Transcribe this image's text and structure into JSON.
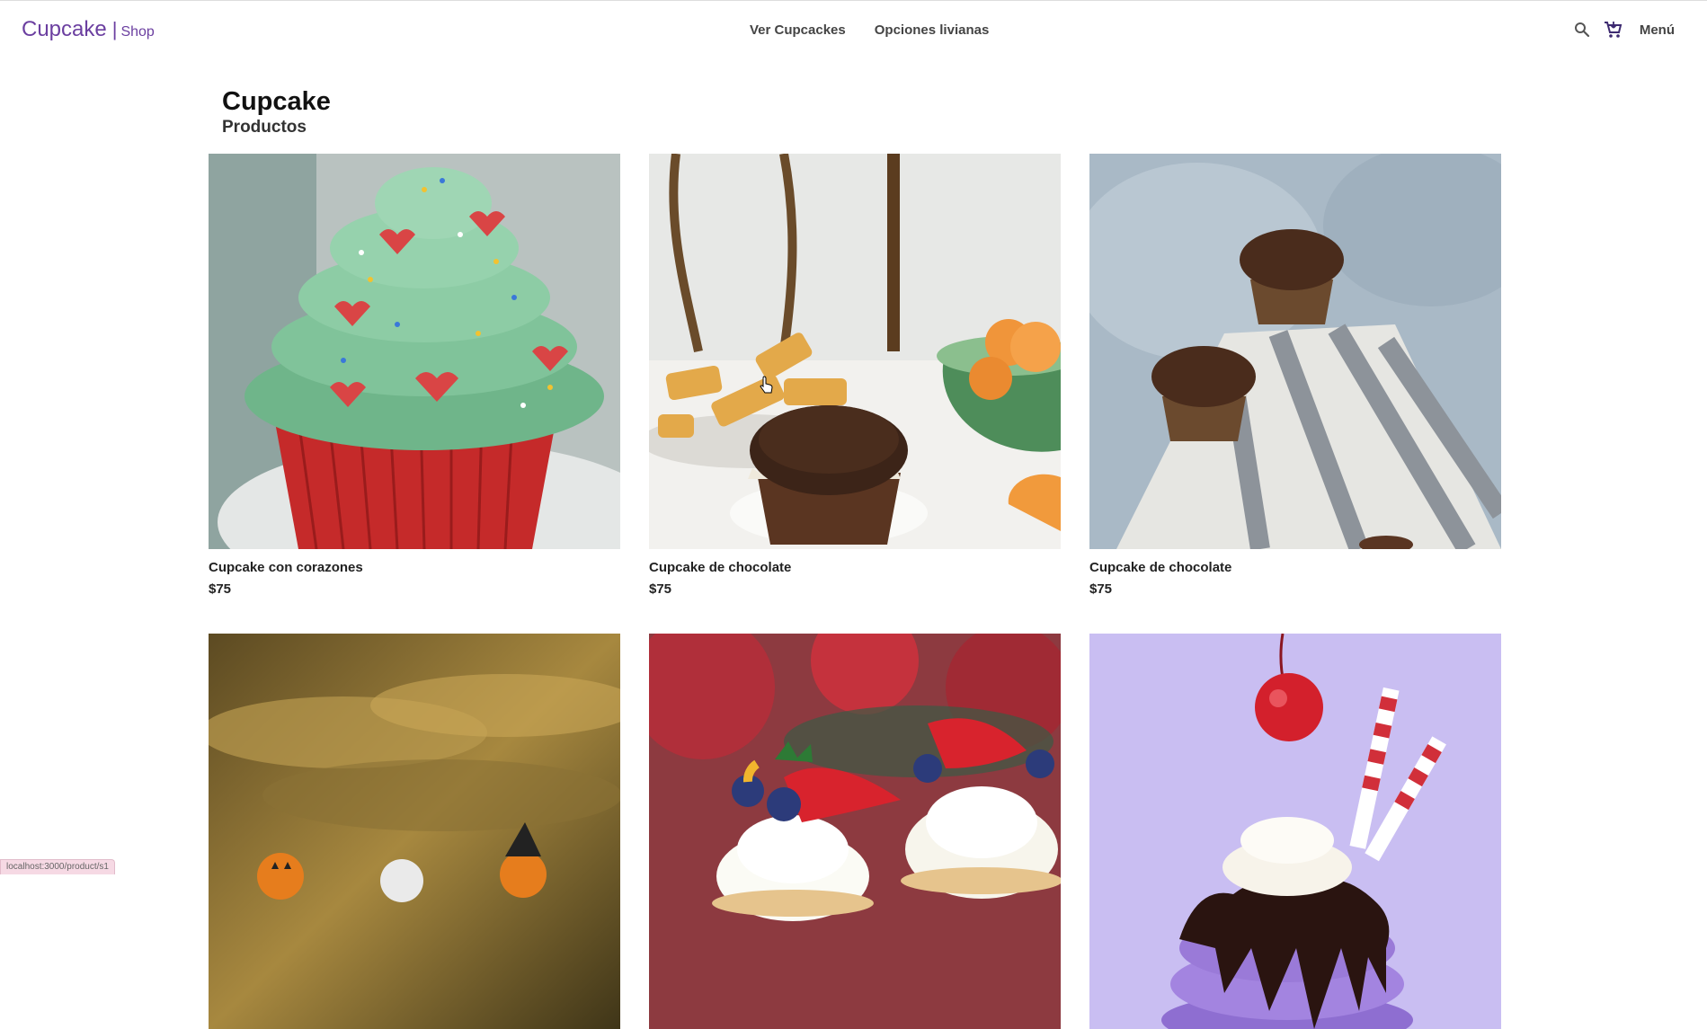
{
  "brand": {
    "name": "Cupcake",
    "separator": "|",
    "sub": "Shop"
  },
  "nav": {
    "items": [
      "Ver Cupcackes",
      "Opciones livianas"
    ]
  },
  "toolbar": {
    "menu_label": "Menú",
    "icons": [
      "search-icon",
      "cart-icon"
    ]
  },
  "page": {
    "title": "Cupcake",
    "subtitle": "Productos"
  },
  "products": [
    {
      "name": "Cupcake con corazones",
      "price": "$75",
      "image": "green-frosting-heart-sprinkles-cupcake"
    },
    {
      "name": "Cupcake de chocolate",
      "price": "$75",
      "image": "chocolate-muffin-with-fruit"
    },
    {
      "name": "Cupcake de chocolate",
      "price": "$75",
      "image": "chocolate-muffins-on-striped-cloth"
    },
    {
      "name": "",
      "price": "",
      "image": "halloween-cupcakes-autumn-background"
    },
    {
      "name": "",
      "price": "",
      "image": "strawberry-blueberry-cream-cupcakes"
    },
    {
      "name": "",
      "price": "",
      "image": "purple-cupcake-cherry-chocolate"
    }
  ],
  "status_url": "localhost:3000/product/s1",
  "colors": {
    "brand": "#6b3fa0",
    "text": "#222222",
    "background": "#ffffff"
  }
}
